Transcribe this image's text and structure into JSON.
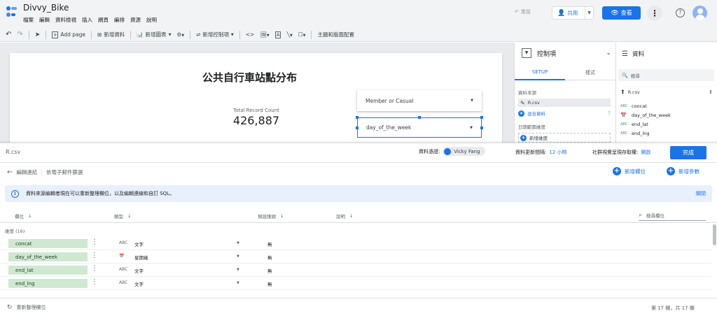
{
  "app": {
    "title": "Divvy_Bike",
    "menus": [
      "檔案",
      "編輯",
      "資料檢視",
      "插入",
      "網頁",
      "編排",
      "資源",
      "說明"
    ],
    "reset_label": "重設",
    "share_label": "共用",
    "view_label": "查看"
  },
  "toolbar": {
    "add_page": "Add page",
    "add_data": "新增資料",
    "add_chart": "新增圖表",
    "add_control": "新增控制項",
    "theme_layout": "主題和版面配置"
  },
  "report": {
    "title": "公共自行車站點分布",
    "scorecard_label": "Total Record Count",
    "scorecard_value": "426,887",
    "dropdown1": "Member or Casual",
    "dropdown2": "day_of_the_week"
  },
  "control_panel": {
    "title": "控制項",
    "tab_setup": "SETUP",
    "tab_style": "樣式",
    "datasource_label": "資料來源",
    "datasource_name": "R.csv",
    "blend_label": "混合資料",
    "daterange_label": "日期範圍維度",
    "add_dimension": "新增維度"
  },
  "data_panel": {
    "title": "資料",
    "search_placeholder": "搜尋",
    "source_name": "R.csv",
    "fields": [
      {
        "type": "ABC",
        "name": "concat"
      },
      {
        "type": "CAL",
        "name": "day_of_the_week"
      },
      {
        "type": "ABC",
        "name": "end_lat"
      },
      {
        "type": "ABC",
        "name": "end_lng"
      }
    ]
  },
  "editor": {
    "source_name": "R.csv",
    "credentials_label": "資料憑證:",
    "owner": "Vicky Fang",
    "refresh_label": "資料更新間隔:",
    "refresh_value": "12 小時",
    "community_label": "社群視覺呈現存取權:",
    "community_value": "開啟",
    "done_label": "完成",
    "back_link": "編輯連結",
    "filter_link": "依電子郵件篩選",
    "add_field": "新增欄位",
    "add_param": "新增參數",
    "info_text": "資料來源編輯者現在可以重新整理欄位，以及編輯連線和自訂 SQL。",
    "dismiss": "關閉",
    "columns": [
      "欄位",
      "類型",
      "預設匯總",
      "說明"
    ],
    "search_fields_placeholder": "搜尋欄位",
    "group_label": "維度 (16)",
    "rows": [
      {
        "name": "concat",
        "type_icon": "ABC",
        "type": "文字",
        "agg": "無"
      },
      {
        "name": "day_of_the_week",
        "type_icon": "CAL",
        "type": "星期幾",
        "agg": "無"
      },
      {
        "name": "end_lat",
        "type_icon": "ABC",
        "type": "文字",
        "agg": "無"
      },
      {
        "name": "end_lng",
        "type_icon": "ABC",
        "type": "文字",
        "agg": "無"
      }
    ],
    "refresh_fields": "重新整理欄位",
    "field_count": "第 17 欄，共 17 欄"
  }
}
